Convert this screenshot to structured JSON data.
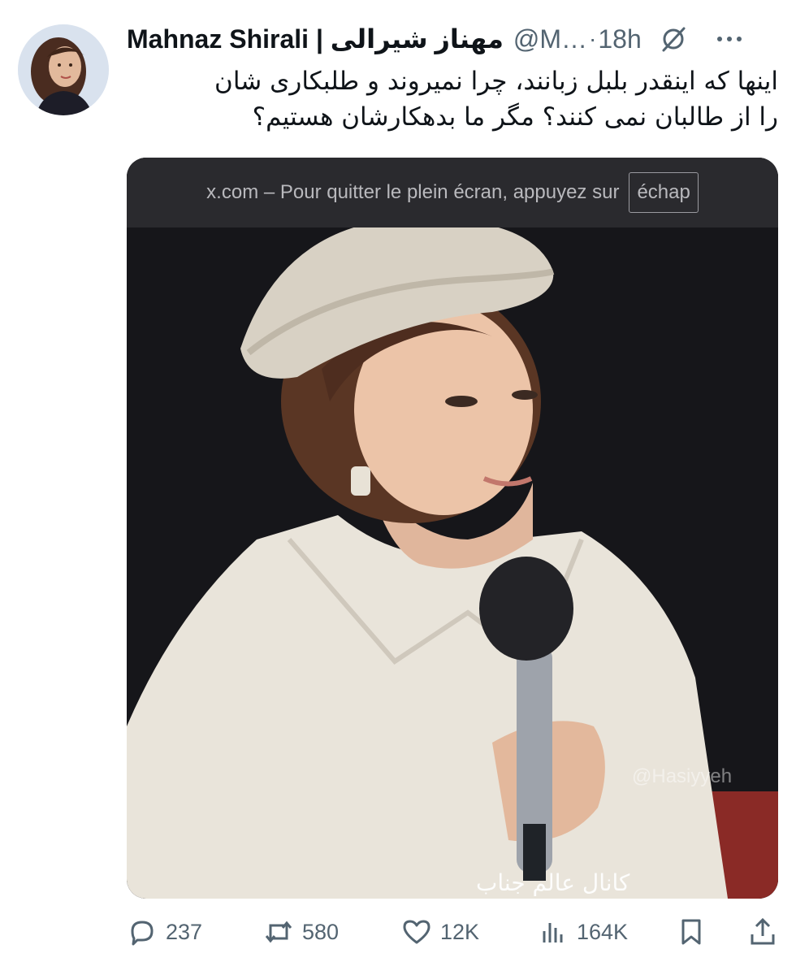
{
  "tweet": {
    "display_name": "Mahnaz Shirali | مهناز شیرالی",
    "handle": "@M…",
    "separator": "·",
    "timestamp": "18h",
    "text_lines": [
      "اینها که اینقدر بلبل زبانند، چرا نمیروند و طلبکاری شان",
      "را از طالبان نمی کنند؟ مگر ما بدهکارشان هستیم؟"
    ]
  },
  "media": {
    "fullscreen_notice": "x.com – Pour quitter le plein écran, appuyez sur",
    "fullscreen_key": "échap",
    "watermark": "@Hasiyyeh",
    "caption_overlay": "کانال عالم جناب"
  },
  "actions": {
    "replies": "237",
    "reposts": "580",
    "likes": "12K",
    "views": "164K"
  },
  "icons": {
    "grok": "grok-slash-icon",
    "more": "more-horizontal-icon",
    "reply": "speech-bubble-icon",
    "repost": "repost-arrows-icon",
    "like": "heart-icon",
    "views": "bar-chart-icon",
    "bookmark": "bookmark-icon",
    "share": "share-upload-icon"
  },
  "colors": {
    "text": "#0f1419",
    "secondary": "#536471",
    "media_background": "#16161a"
  }
}
